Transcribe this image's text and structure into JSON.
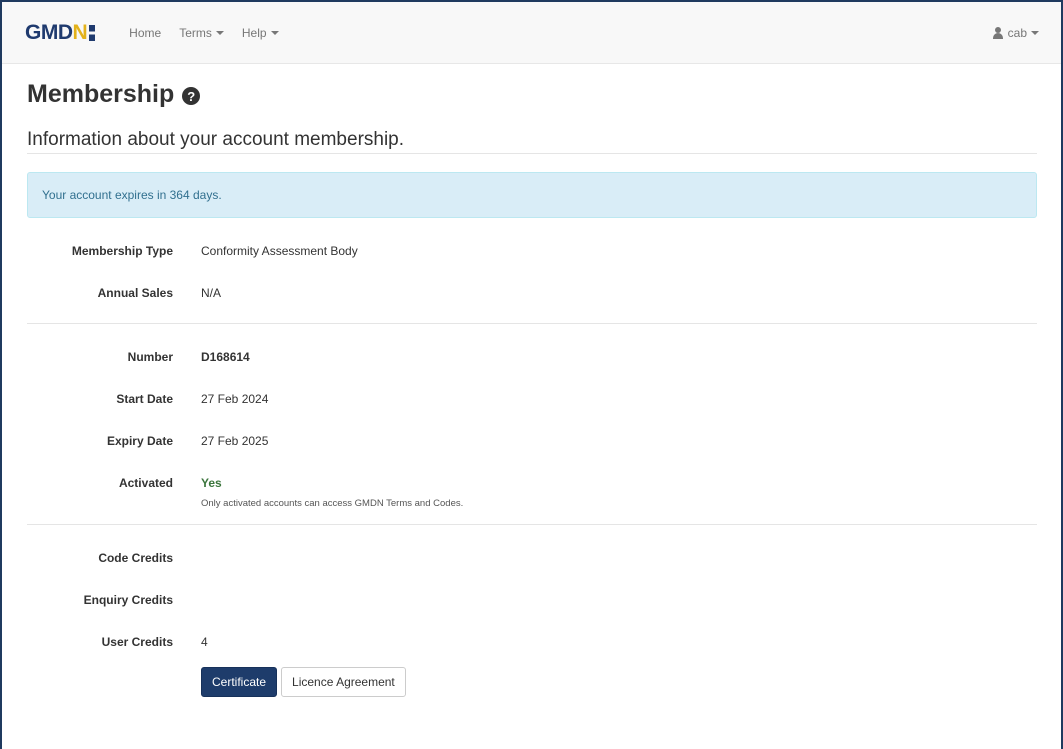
{
  "navbar": {
    "brand": "GMDN",
    "home": "Home",
    "terms": "Terms",
    "help": "Help",
    "user": "cab"
  },
  "page": {
    "title": "Membership",
    "subtitle": "Information about your account membership.",
    "alert": "Your account expires in 364 days."
  },
  "membership": {
    "type_label": "Membership Type",
    "type_value": "Conformity Assessment Body",
    "sales_label": "Annual Sales",
    "sales_value": "N/A",
    "number_label": "Number",
    "number_value": "D168614",
    "start_label": "Start Date",
    "start_value": "27 Feb 2024",
    "expiry_label": "Expiry Date",
    "expiry_value": "27 Feb 2025",
    "activated_label": "Activated",
    "activated_value": "Yes",
    "activated_note": "Only activated accounts can access GMDN Terms and Codes.",
    "code_credits_label": "Code Credits",
    "code_credits_value": "",
    "enquiry_credits_label": "Enquiry Credits",
    "enquiry_credits_value": "",
    "user_credits_label": "User Credits",
    "user_credits_value": "4"
  },
  "buttons": {
    "certificate": "Certificate",
    "licence": "Licence Agreement"
  },
  "colors": {
    "brand_blue": "#1f3a6e",
    "brand_gold": "#e3b21b",
    "primary_button": "#1e3c6b",
    "alert_bg": "#d9edf7",
    "success_text": "#3c763d"
  }
}
